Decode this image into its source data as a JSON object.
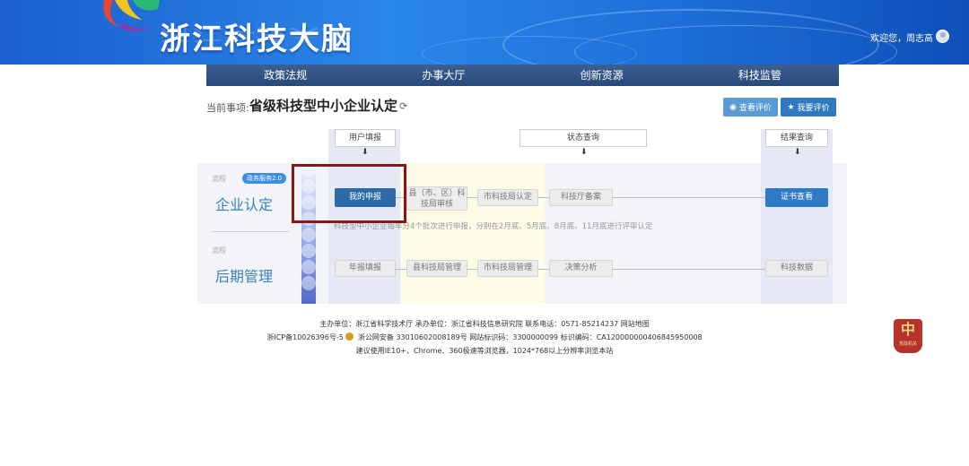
{
  "header": {
    "site_title": "浙江科技大脑",
    "welcome": "欢迎您，周志高"
  },
  "nav": {
    "items": [
      "政策法规",
      "办事大厅",
      "创新资源",
      "科技监管"
    ]
  },
  "current": {
    "label": "当前事项:",
    "title": "省级科技型中小企业认定",
    "view_rating": "查看评价",
    "my_rating": "我要评价"
  },
  "stages": {
    "user_fill": "用户填报",
    "status_query": "状态查询",
    "result_query": "结果查询"
  },
  "rows": [
    {
      "small": "流程",
      "title": "企业认定",
      "badge": "政务服务2.0",
      "steps": [
        "我的申报",
        "县（市、区）科技局审核",
        "市科技局认定",
        "科技厅备案",
        "证书查看"
      ],
      "note": "科技型中小企业每年分4个批次进行申报，分别在2月底、5月底、8月底、11月底进行评审认定"
    },
    {
      "small": "流程",
      "title": "后期管理",
      "steps": [
        "年报填报",
        "县科技局管理",
        "市科技局管理",
        "决策分析",
        "科技数据"
      ]
    }
  ],
  "footer": {
    "line1": "主办单位：浙江省科学技术厅  承办单位：浙江省科技信息研究院 联系电话：0571-85214237 网站地图",
    "line2_a": "浙ICP备10026396号-5",
    "line2_b": "浙公网安备 33010602008189号  网站标识码：3300000099  标识编码：CA120000000406845950008",
    "line3": "建议使用IE10+、Chrome、360极速等浏览器，1024*768以上分辨率浏览本站",
    "gov_badge": "党政机关"
  },
  "colors": {
    "nav_bg": "#2e5285",
    "active_step": "#2d6aa8",
    "result_step": "#2f7ac6",
    "highlight_box": "#8b1414",
    "row_title": "#3a7fc1"
  }
}
